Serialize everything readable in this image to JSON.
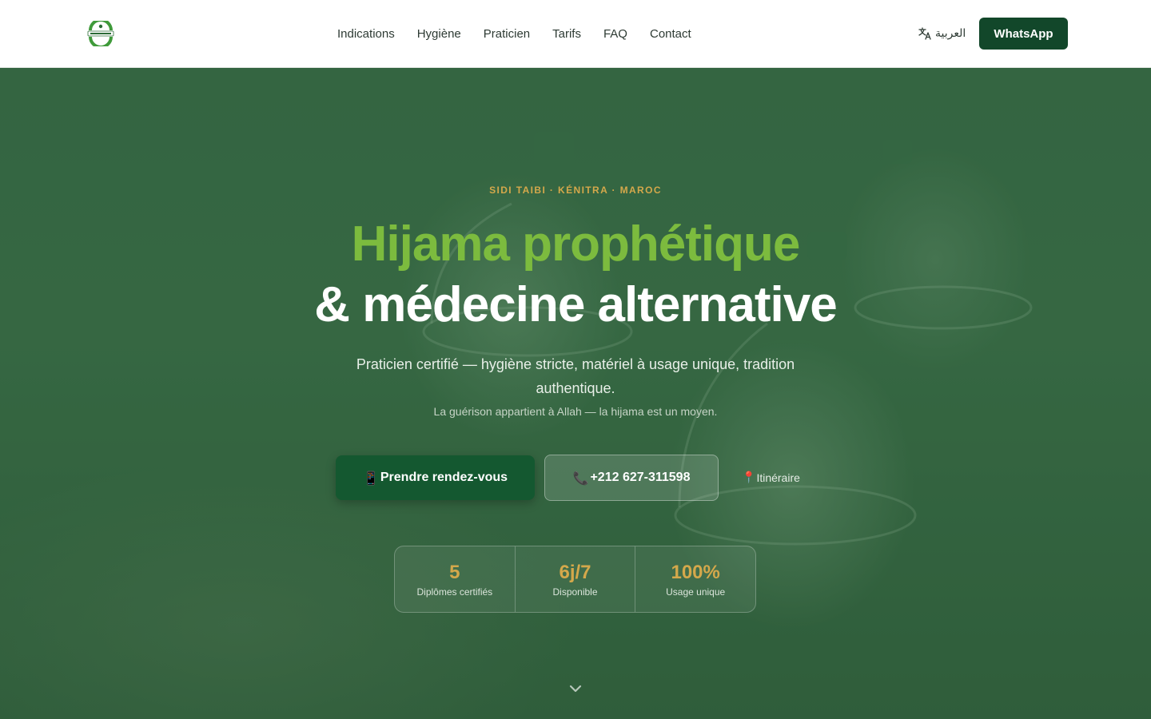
{
  "header": {
    "nav": [
      {
        "label": "Indications"
      },
      {
        "label": "Hygiène"
      },
      {
        "label": "Praticien"
      },
      {
        "label": "Tarifs"
      },
      {
        "label": "FAQ"
      },
      {
        "label": "Contact"
      }
    ],
    "language_label": "العربية",
    "whatsapp_label": "WhatsApp"
  },
  "hero": {
    "eyebrow": "SIDI TAIBI · KÉNITRA · MAROC",
    "title_line1": "Hijama prophétique",
    "title_line2": "& médecine alternative",
    "subtitle": "Praticien certifié — hygiène stricte, matériel à usage unique, tradition authentique.",
    "note": "La guérison appartient à Allah — la hijama est un moyen.",
    "cta_primary": {
      "icon": "📱",
      "label": "Prendre rendez-vous"
    },
    "cta_phone": {
      "icon": "📞",
      "label": "+212 627-311598"
    },
    "cta_itinerary": {
      "icon": "📍",
      "label": "Itinéraire"
    },
    "stats": [
      {
        "value": "5",
        "label": "Diplômes certifiés"
      },
      {
        "value": "6j/7",
        "label": "Disponible"
      },
      {
        "value": "100%",
        "label": "Usage unique"
      }
    ]
  },
  "colors": {
    "brand_dark": "#12472a",
    "accent_green": "#7cbb3e",
    "accent_gold": "#d4a84b"
  },
  "icons": {
    "logo": "clinic-logo",
    "language": "translate-icon",
    "scroll": "chevron-down-icon"
  }
}
